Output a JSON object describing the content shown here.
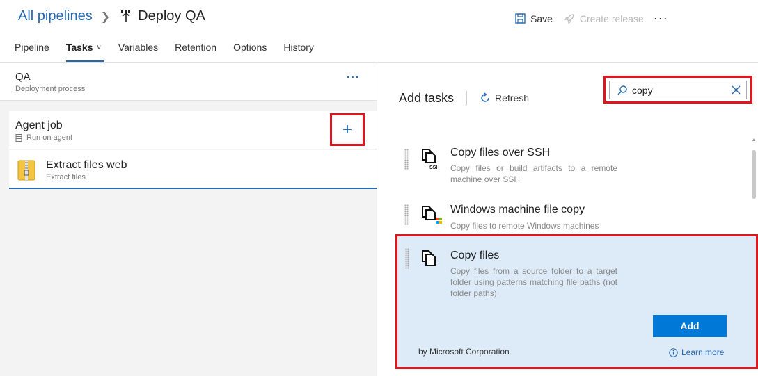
{
  "header": {
    "breadcrumb_root": "All pipelines",
    "title": "Deploy QA",
    "save_label": "Save",
    "create_release_label": "Create release",
    "more_label": "···"
  },
  "tabs": [
    {
      "label": "Pipeline"
    },
    {
      "label": "Tasks",
      "active": true
    },
    {
      "label": "Variables"
    },
    {
      "label": "Retention"
    },
    {
      "label": "Options"
    },
    {
      "label": "History"
    }
  ],
  "stage": {
    "name": "QA",
    "subtitle": "Deployment process",
    "more_label": "···"
  },
  "agent_job": {
    "name": "Agent job",
    "subtitle": "Run on agent",
    "add_label": "+"
  },
  "task": {
    "name": "Extract files web",
    "subtitle": "Extract files"
  },
  "add_tasks": {
    "title": "Add tasks",
    "refresh_label": "Refresh",
    "search_value": "copy",
    "results": [
      {
        "name": "Copy files over SSH",
        "description": "Copy files or build artifacts to a remote machine over SSH",
        "icon": "ssh-copy-icon"
      },
      {
        "name": "Windows machine file copy",
        "description": "Copy files to remote Windows machines",
        "icon": "windows-copy-icon"
      },
      {
        "name": "Copy files",
        "description": "Copy files from a source folder to a target folder using patterns matching file paths (not folder paths)",
        "icon": "copy-files-icon",
        "selected": true
      }
    ],
    "add_button_label": "Add",
    "publisher": "by Microsoft Corporation",
    "learn_more_label": "Learn more"
  },
  "colors": {
    "accent": "#0078d7",
    "link": "#2569b3",
    "highlight_border": "#e0161e",
    "selected_bg": "#ddeaf7"
  }
}
